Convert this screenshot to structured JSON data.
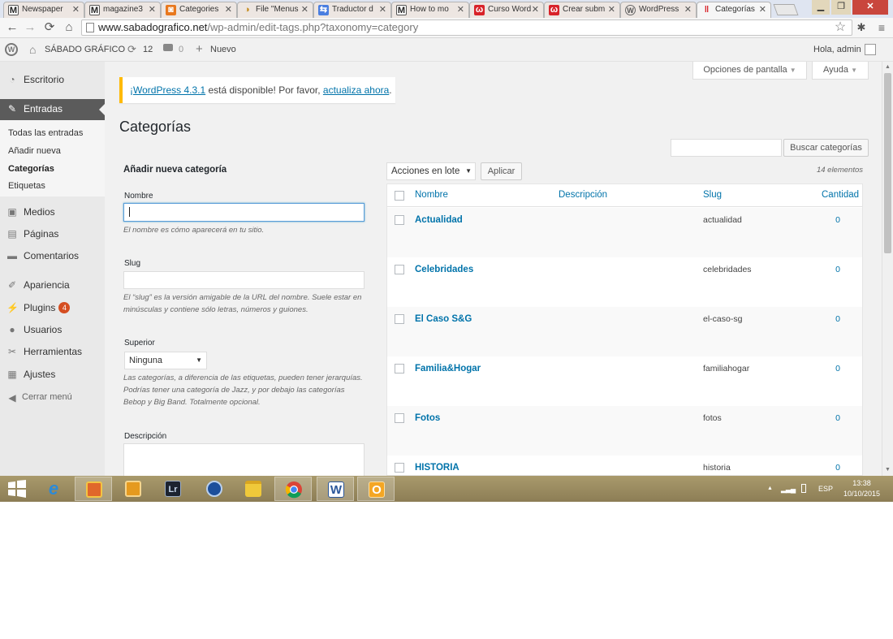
{
  "browser": {
    "tabs": [
      {
        "label": "Newspaper",
        "favicon": "M"
      },
      {
        "label": "magazine3",
        "favicon": "M"
      },
      {
        "label": "Categories",
        "favicon": "◙"
      },
      {
        "label": "File \"Menus",
        "favicon": "◑"
      },
      {
        "label": "Traductor d",
        "favicon": "⇆"
      },
      {
        "label": "How to mo",
        "favicon": "M"
      },
      {
        "label": "Curso Word",
        "favicon": "ω"
      },
      {
        "label": "Crear subm",
        "favicon": "ω"
      },
      {
        "label": "WordPress",
        "favicon": "W"
      },
      {
        "label": "Categorías",
        "favicon": "‖"
      }
    ],
    "url_host": "www.sabadografico.net",
    "url_path": "/wp-admin/edit-tags.php?taxonomy=category"
  },
  "adminbar": {
    "site_name": "SÁBADO GRÁFICO",
    "updates_count": "12",
    "comments_count": "0",
    "new_label": "Nuevo",
    "greeting": "Hola, admin"
  },
  "menu": {
    "dashboard": "Escritorio",
    "posts": "Entradas",
    "submenu": [
      "Todas las entradas",
      "Añadir nueva",
      "Categorías",
      "Etiquetas"
    ],
    "media": "Medios",
    "pages": "Páginas",
    "comments": "Comentarios",
    "appearance": "Apariencia",
    "plugins": "Plugins",
    "plugins_badge": "4",
    "users": "Usuarios",
    "tools": "Herramientas",
    "settings": "Ajustes",
    "collapse": "Cerrar menú"
  },
  "screen": {
    "screen_options": "Opciones de pantalla",
    "help": "Ayuda"
  },
  "notice": {
    "link1": "¡WordPress 4.3.1",
    "middle": " está disponible! Por favor, ",
    "link2": "actualiza ahora",
    "end": "."
  },
  "page": {
    "title": "Categorías",
    "search_button": "Buscar categorías",
    "search_value": ""
  },
  "form": {
    "heading": "Añadir nueva categoría",
    "name_label": "Nombre",
    "name_value": "",
    "name_help": "El nombre es cómo aparecerá en tu sitio.",
    "slug_label": "Slug",
    "slug_value": "",
    "slug_help": "El “slug” es la versión amigable de la URL del nombre. Suele estar en minúsculas y contiene sólo letras, números y guiones.",
    "parent_label": "Superior",
    "parent_value": "Ninguna",
    "parent_help": "Las categorías, a diferencia de las etiquetas, pueden tener jerarquías. Podrías tener una categoría de Jazz, y por debajo las categorías Bebop y Big Band. Totalmente opcional.",
    "description_label": "Descripción",
    "description_value": ""
  },
  "table": {
    "bulk_actions": "Acciones en lote",
    "apply": "Aplicar",
    "count_text": "14 elementos",
    "headers": {
      "name": "Nombre",
      "description": "Descripción",
      "slug": "Slug",
      "count": "Cantidad"
    },
    "rows": [
      {
        "name": "Actualidad",
        "slug": "actualidad",
        "count": "0"
      },
      {
        "name": "Celebridades",
        "slug": "celebridades",
        "count": "0"
      },
      {
        "name": "El Caso S&G",
        "slug": "el-caso-sg",
        "count": "0"
      },
      {
        "name": "Familia&Hogar",
        "slug": "familiahogar",
        "count": "0"
      },
      {
        "name": "Fotos",
        "slug": "fotos",
        "count": "0"
      },
      {
        "name": "HISTORIA",
        "slug": "historia",
        "count": "0"
      }
    ]
  },
  "taskbar": {
    "apps": [
      "windows-start",
      "internet-explorer",
      "photos",
      "notes",
      "lightroom",
      "explorer-app",
      "file-explorer",
      "chrome",
      "word",
      "outlook"
    ],
    "lightroom_label": "Lr",
    "language": "ESP",
    "time": "13:38",
    "date": "10/10/2015"
  },
  "colors": {
    "link": "#0073aa",
    "notice_border": "#ffba00",
    "menu_current": "#5b5b5b",
    "badge": "#d54e21"
  }
}
